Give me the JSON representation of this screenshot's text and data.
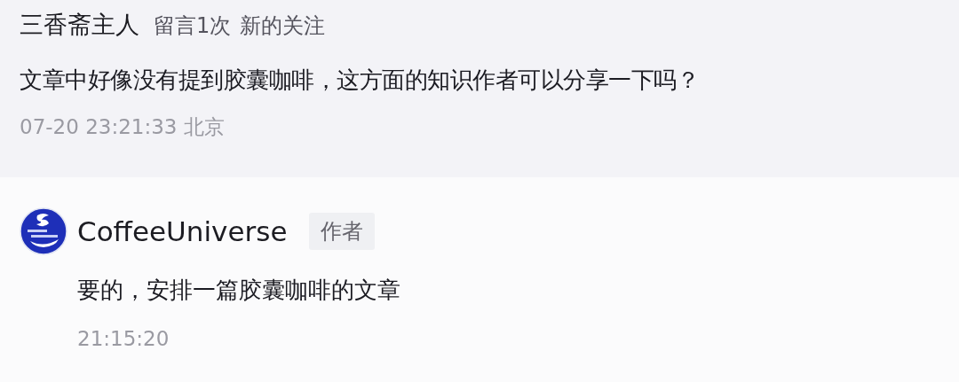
{
  "comment": {
    "author": "三香斋主人",
    "meta": [
      "留言1次",
      "新的关注"
    ],
    "text": "文章中好像没有提到胶囊咖啡，这方面的知识作者可以分享一下吗？",
    "time": "07-20 23:21:33 北京"
  },
  "reply": {
    "author": "CoffeeUniverse",
    "badge": "作者",
    "text": "要的，安排一篇胶囊咖啡的文章",
    "time": "21:15:20"
  }
}
